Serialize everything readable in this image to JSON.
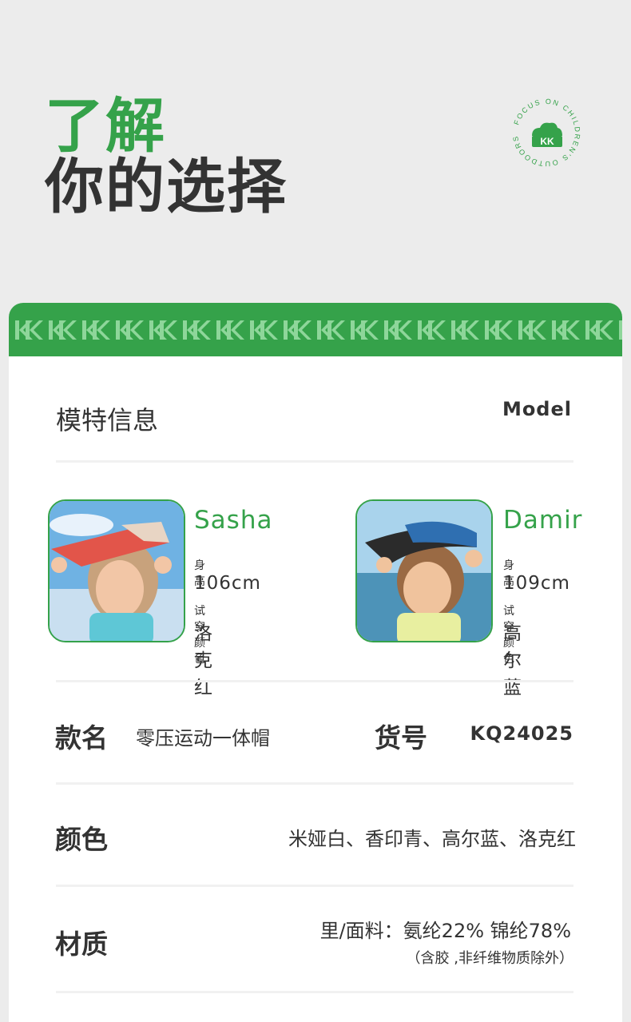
{
  "hero": {
    "line1": "了解",
    "line2": "你的选择"
  },
  "badge": {
    "ring_text": "FOCUS ON CHILDREN'S OUTDOORS",
    "logo_text": "KK"
  },
  "colors": {
    "brand_green": "#35a24a",
    "text_dark": "#333333",
    "background": "#ececec"
  },
  "model_section": {
    "title": "模特信息",
    "label_en": "Model",
    "models": [
      {
        "name": "Sasha",
        "height_label": "身高",
        "height_value": "106cm",
        "color_label": "试穿颜色",
        "color_value": "洛克红"
      },
      {
        "name": "Damir",
        "height_label": "身高",
        "height_value": "109cm",
        "color_label": "试穿颜色",
        "color_value": "高尔蓝"
      }
    ]
  },
  "product": {
    "name_label": "款名",
    "name_value": "零压运动一体帽",
    "sku_label": "货号",
    "sku_value": "KQ24025",
    "color_label": "颜色",
    "color_value": "米娅白、香印青、高尔蓝、洛克红",
    "material_label": "材质",
    "material_value": "里/面料：氨纶22%  锦纶78%",
    "material_note": "（含胶 ,非纤维物质除外）"
  }
}
